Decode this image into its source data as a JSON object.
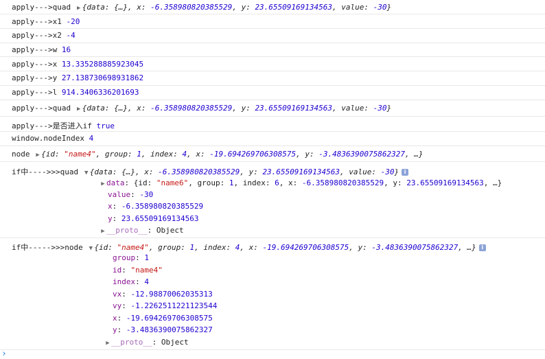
{
  "lines": [
    {
      "label": "apply--->quad",
      "quad": {
        "data_label": "data",
        "data_val": "{…}",
        "x": "-6.358980820385529",
        "y": "23.65509169134563",
        "value": "-30"
      }
    },
    {
      "label": "apply--->x1",
      "value": "-20"
    },
    {
      "label": "apply--->x2",
      "value": "-4"
    },
    {
      "label": "apply--->w",
      "value": "16"
    },
    {
      "label": "apply--->x",
      "value": "13.335288885923045"
    },
    {
      "label": "apply--->y",
      "value": "27.138730698931862"
    },
    {
      "label": "apply--->l",
      "value": "914.3406336201693"
    },
    {
      "label": "apply--->quad",
      "quad": {
        "data_label": "data",
        "data_val": "{…}",
        "x": "-6.358980820385529",
        "y": "23.65509169134563",
        "value": "-30"
      }
    },
    {
      "label": "apply--->是否进入if",
      "value": "true"
    },
    {
      "label": "window.nodeIndex",
      "value": "4"
    }
  ],
  "node_line": {
    "label": "node",
    "id": "\"name4\"",
    "group": "1",
    "index": "4",
    "x": "-19.694269706308575",
    "y": "-3.4836390075862327",
    "more": "…"
  },
  "if_quad": {
    "label": "if中---->>>quad",
    "summary": {
      "data_val": "{…}",
      "x": "-6.358980820385529",
      "y": "23.65509169134563",
      "value": "-30"
    },
    "data_row": {
      "key": "data",
      "id": "\"name6\"",
      "group": "1",
      "index": "6",
      "x": "-6.358980820385529",
      "y": "23.65509169134563",
      "more": "…"
    },
    "props": [
      {
        "key": "value",
        "val": "-30"
      },
      {
        "key": "x",
        "val": "-6.358980820385529"
      },
      {
        "key": "y",
        "val": "23.65509169134563"
      }
    ],
    "proto": {
      "key": "__proto__",
      "val": "Object"
    }
  },
  "if_node": {
    "label": "if中----->>>node",
    "summary": {
      "id": "\"name4\"",
      "group": "1",
      "index": "4",
      "x": "-19.694269706308575",
      "y": "-3.4836390075862327",
      "more": "…"
    },
    "props": [
      {
        "key": "group",
        "val": "1"
      },
      {
        "key": "id",
        "val": "\"name4\""
      },
      {
        "key": "index",
        "val": "4"
      },
      {
        "key": "vx",
        "val": "-12.98870062035313"
      },
      {
        "key": "vy",
        "val": "-1.2262511221123544"
      },
      {
        "key": "x",
        "val": "-19.694269706308575"
      },
      {
        "key": "y",
        "val": "-3.4836390075862327"
      }
    ],
    "proto": {
      "key": "__proto__",
      "val": "Object"
    }
  },
  "keys": {
    "id": "id",
    "group": "group",
    "index": "index",
    "x": "x",
    "y": "y",
    "value": "value",
    "data": "data"
  },
  "prompt_glyph": "›"
}
